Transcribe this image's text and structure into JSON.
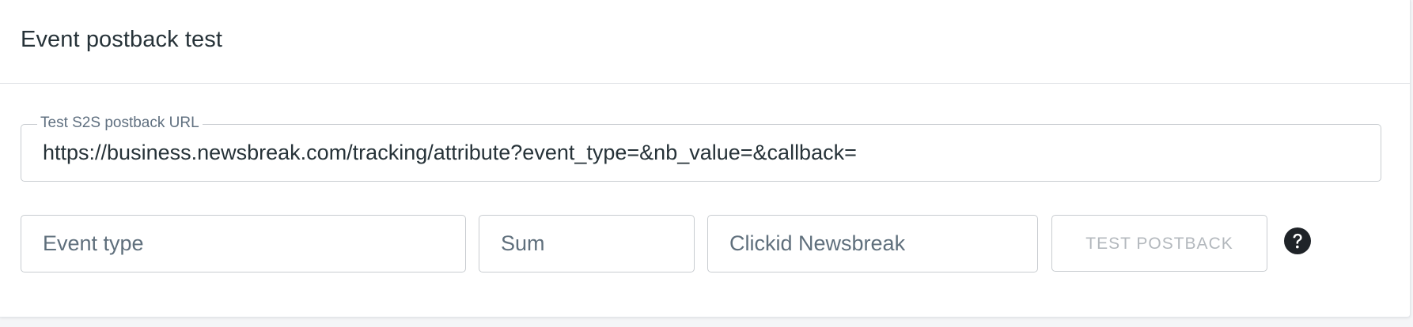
{
  "card": {
    "title": "Event postback test"
  },
  "url_field": {
    "label": "Test S2S postback URL",
    "value": "https://business.newsbreak.com/tracking/attribute?event_type=&nb_value=&callback="
  },
  "inputs": {
    "event_type": {
      "placeholder": "Event type",
      "value": ""
    },
    "sum": {
      "placeholder": "Sum",
      "value": ""
    },
    "clickid": {
      "placeholder": "Clickid Newsbreak",
      "value": ""
    }
  },
  "test_button": {
    "label": "TEST POSTBACK",
    "disabled": true
  },
  "icons": {
    "help": "question-circle-icon"
  },
  "colors": {
    "title_text": "#263238",
    "border": "#c8ccd0",
    "disabled_text": "#b3b8bd",
    "help_icon": "#1f2328"
  }
}
